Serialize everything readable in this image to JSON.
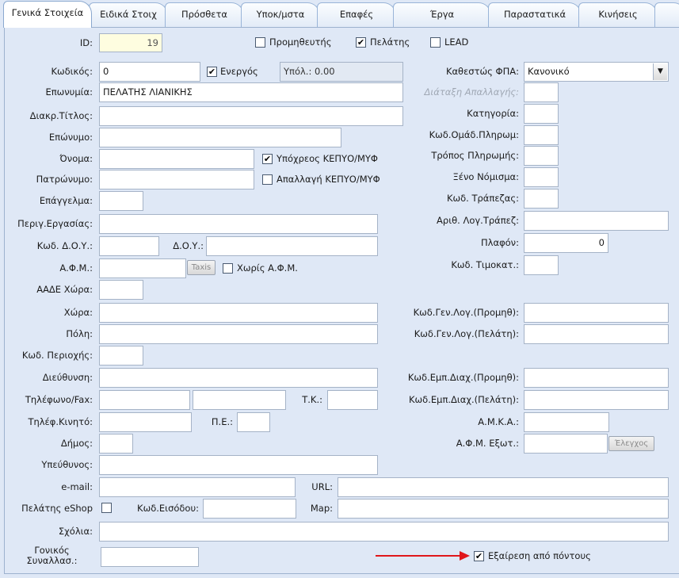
{
  "tabs": [
    "Γενικά Στοιχεία",
    "Ειδικά Στοιχ",
    "Πρόσθετα",
    "Υποκ/μστα",
    "Επαφές",
    "Έργα",
    "Παραστατικά",
    "Κινήσεις"
  ],
  "row_id": {
    "id_label": "ID:",
    "id_value": "19",
    "supplier_label": "Προμηθευτής",
    "supplier_checked": false,
    "customer_label": "Πελάτης",
    "customer_checked": true,
    "lead_label": "LEAD",
    "lead_checked": false
  },
  "left": {
    "code_label": "Κωδικός:",
    "code_value": "0",
    "active_label": "Ενεργός",
    "active_checked": true,
    "balance": "Υπόλ.: 0.00",
    "name_label": "Επωνυμία:",
    "name_value": "ΠΕΛΑΤΗΣ ΛΙΑΝΙΚΗΣ",
    "title_label": "Διακρ.Τίτλος:",
    "surname_label": "Επώνυμο:",
    "firstname_label": "Όνομα:",
    "kepyo_obliged_label": "Υπόχρεος ΚΕΠΥΟ/ΜΥΦ",
    "kepyo_obliged_checked": true,
    "father_label": "Πατρώνυμο:",
    "kepyo_exempt_label": "Απαλλαγή ΚΕΠΥΟ/ΜΥΦ",
    "kepyo_exempt_checked": false,
    "profession_label": "Επάγγελμα:",
    "work_desc_label": "Περιγ.Εργασίας:",
    "doy_code_label": "Κωδ. Δ.Ο.Υ.:",
    "doy_label": "Δ.Ο.Υ.:",
    "afm_label": "Α.Φ.Μ.:",
    "taxis_button": "Taxis",
    "no_afm_label": "Χωρίς Α.Φ.Μ.",
    "no_afm_checked": false,
    "aade_country_label": "ΑΑΔΕ Χώρα:",
    "country_label": "Χώρα:",
    "city_label": "Πόλη:",
    "region_code_label": "Κωδ. Περιοχής:",
    "address_label": "Διεύθυνση:",
    "phone_label": "Τηλέφωνο/Fax:",
    "postal_label": "Τ.Κ.:",
    "mobile_label": "Τηλέφ.Κινητό:",
    "pe_label": "Π.Ε.:",
    "municipality_label": "Δήμος:",
    "responsible_label": "Υπεύθυνος:",
    "email_label": "e-mail:",
    "url_label": "URL:",
    "eshop_label": "Πελάτης eShop",
    "eshop_checked": false,
    "login_code_label": "Κωδ.Εισόδου:",
    "map_label": "Map:",
    "comments_label": "Σχόλια:",
    "parent_label": "Γονικός Συναλλασ.:",
    "exclude_points_label": "Εξαίρεση από πόντους",
    "exclude_points_checked": true
  },
  "right": {
    "vat_status_label": "Καθεστώς ΦΠΑ:",
    "vat_status_value": "Κανονικό",
    "exemption_label": "Διάταξη Απαλλαγής:",
    "category_label": "Κατηγορία:",
    "payment_group_label": "Κωδ.Ομάδ.Πληρωμ:",
    "payment_method_label": "Τρόπος Πληρωμής:",
    "currency_label": "Ξένο Νόμισμα:",
    "bank_code_label": "Κωδ. Τράπεζας:",
    "bank_account_label": "Αριθ. Λογ.Τράπεζ:",
    "ceiling_label": "Πλαφόν:",
    "ceiling_value": "0",
    "pricelist_label": "Κωδ. Τιμοκατ.:",
    "gl_supplier_label": "Κωδ.Γεν.Λογ.(Προμηθ):",
    "gl_customer_label": "Κωδ.Γεν.Λογ.(Πελάτη):",
    "trade_supplier_label": "Κωδ.Εμπ.Διαχ.(Προμηθ):",
    "trade_customer_label": "Κωδ.Εμπ.Διαχ.(Πελάτη):",
    "amka_label": "Α.Μ.Κ.Α.:",
    "foreign_afm_label": "Α.Φ.Μ. Εξωτ.:",
    "check_button": "Έλεγχος"
  },
  "colors": {
    "annotation_arrow": "#e0161b",
    "panel_bg": "#dfe8f6"
  }
}
